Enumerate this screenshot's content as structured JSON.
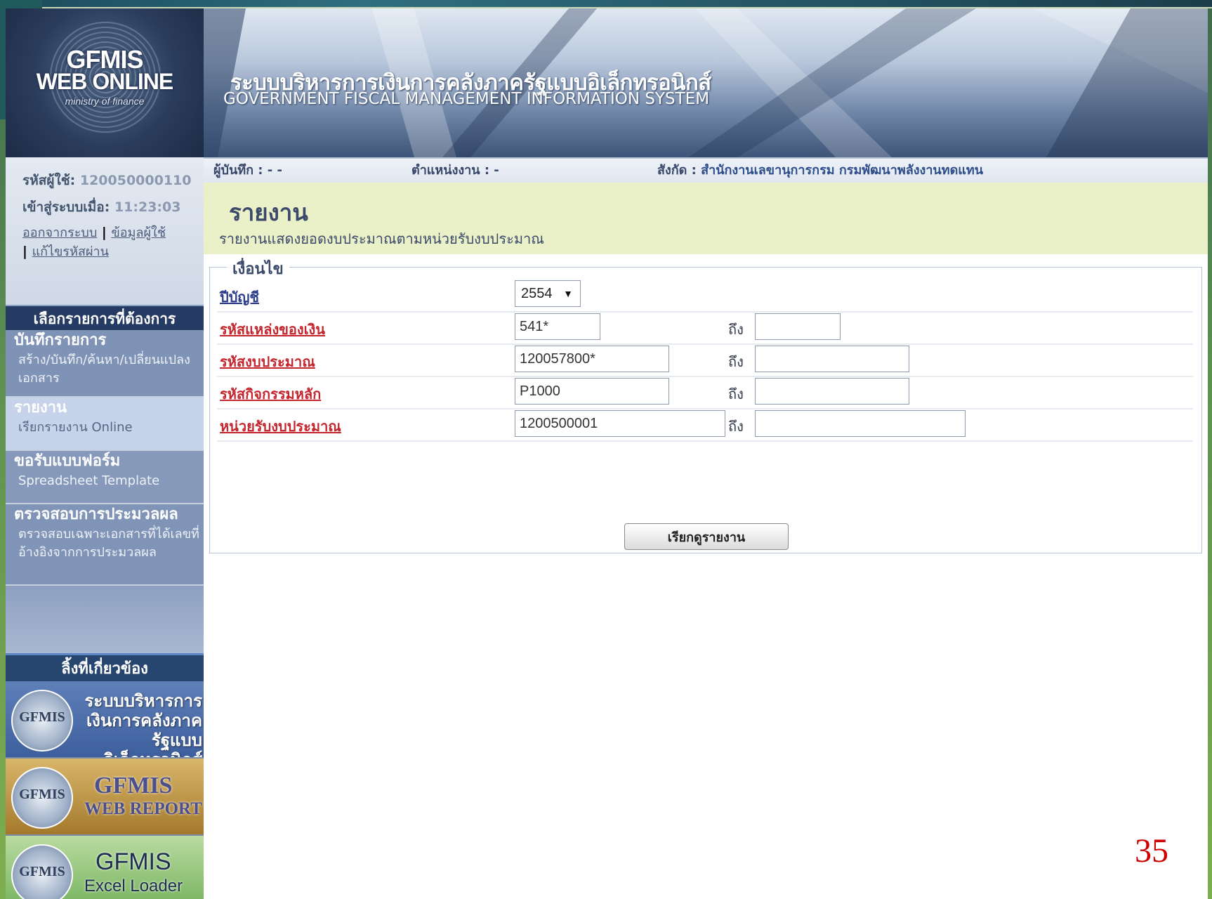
{
  "sidebar": {
    "logo": {
      "line1": "GFMIS",
      "line2": "WEB ONLINE",
      "line3": "ministry of finance"
    },
    "user": {
      "id_label": "รหัสผู้ใช้:",
      "id_value": "120050000110",
      "login_label": "เข้าสู่ระบบเมื่อ:",
      "login_time": "11:23:03",
      "logout_link": "ออกจากระบบ",
      "profile_link": "ข้อมูลผู้ใช้",
      "change_password_link": "แก้ไขรหัสผ่าน",
      "separator": "|"
    },
    "menu_header": "เลือกรายการที่ต้องการ",
    "menu": [
      {
        "title": "บันทึกรายการ",
        "desc": "สร้าง/บันทึก/ค้นหา/เปลี่ยนแปลง เอกสาร"
      },
      {
        "title": "รายงาน",
        "desc": "เรียกรายงาน Online"
      },
      {
        "title": "ขอรับแบบฟอร์ม",
        "desc": "Spreadsheet Template"
      },
      {
        "title": "ตรวจสอบการประมวลผล",
        "desc": "ตรวจสอบเฉพาะเอกสารที่ได้เลขที่อ้างอิงจากการประมวลผล"
      }
    ],
    "links_header": "ลิ้งที่เกี่ยวข้อง",
    "banners": [
      {
        "logo": "GFMIS",
        "text": "ระบบบริหารการเงินการคลังภาครัฐแบบอิเล็กทรอนิกส์"
      },
      {
        "logo": "GFMIS",
        "title": "GFMIS",
        "subtitle": "WEB REPORT"
      },
      {
        "logo": "GFMIS",
        "title": "GFMIS",
        "subtitle": "Excel Loader"
      }
    ]
  },
  "header": {
    "title_th": "ระบบบริหารการเงินการคลังภาครัฐแบบอิเล็กทรอนิกส์",
    "title_en": "GOVERNMENT FISCAL MANAGEMENT INFORMATION SYSTEM"
  },
  "infobar": {
    "recorder": "ผู้บันทึก : - -",
    "position": "ตำแหน่งงาน : -",
    "org_label": "สังกัด :",
    "org_value": "สำนักงานเลขานุการกรม กรมพัฒนาพลังงานทดแทน"
  },
  "page": {
    "title": "รายงาน",
    "subtitle": "รายงานแสดงยอดงบประมาณตามหน่วยรับงบประมาณ"
  },
  "form": {
    "legend": "เงื่อนไข",
    "to_label": "ถึง",
    "fiscal_year": {
      "label": "ปีบัญชี",
      "value": "2554"
    },
    "rows": [
      {
        "label": "รหัสแหล่งของเงิน",
        "from": "541*",
        "to": ""
      },
      {
        "label": "รหัสงบประมาณ",
        "from": "120057800*",
        "to": ""
      },
      {
        "label": "รหัสกิจกรรมหลัก",
        "from": "P1000",
        "to": ""
      },
      {
        "label": "หน่วยรับงบประมาณ",
        "from": "1200500001",
        "to": ""
      }
    ],
    "submit_label": "เรียกดูรายงาน"
  },
  "slide": {
    "page_number": "35"
  },
  "colors": {
    "sidebar_header": "#253b63",
    "title_panel": "#eaf0c8",
    "required_label": "#c4262e",
    "page_number": "#cc0000"
  }
}
